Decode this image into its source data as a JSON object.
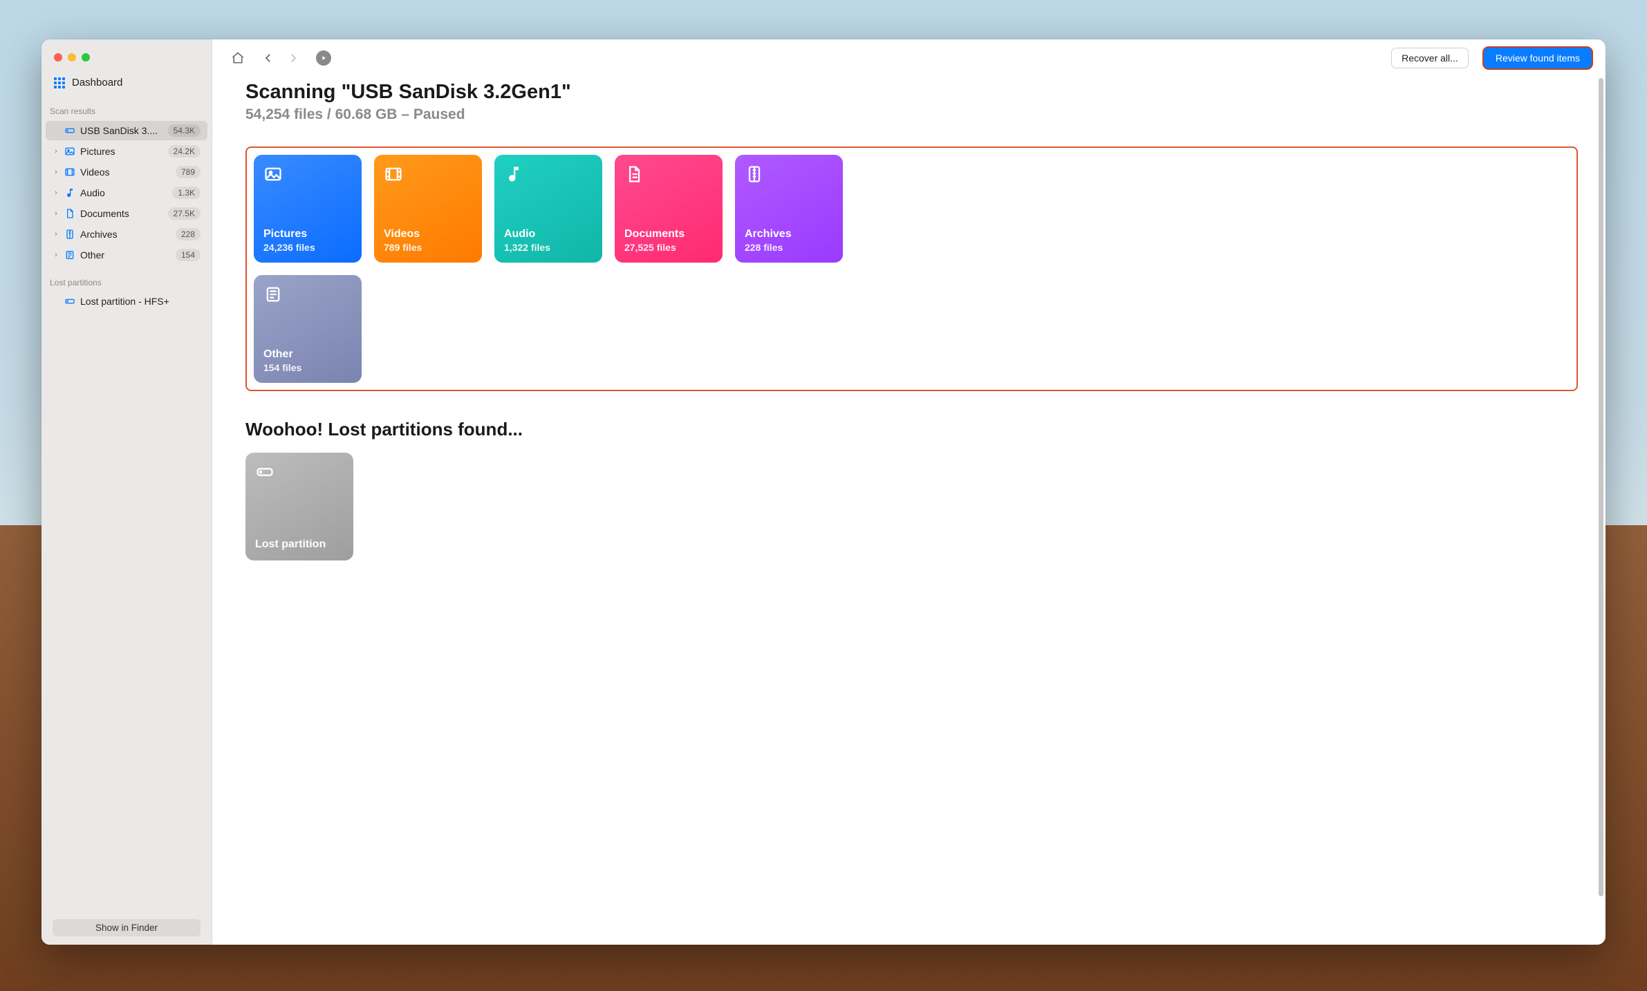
{
  "sidebar": {
    "dashboard_label": "Dashboard",
    "scan_results_label": "Scan results",
    "items": [
      {
        "label": "USB  SanDisk 3....",
        "count": "54.3K",
        "icon": "drive",
        "selected": true
      },
      {
        "label": "Pictures",
        "count": "24.2K",
        "icon": "pictures"
      },
      {
        "label": "Videos",
        "count": "789",
        "icon": "videos"
      },
      {
        "label": "Audio",
        "count": "1.3K",
        "icon": "audio"
      },
      {
        "label": "Documents",
        "count": "27.5K",
        "icon": "documents"
      },
      {
        "label": "Archives",
        "count": "228",
        "icon": "archives"
      },
      {
        "label": "Other",
        "count": "154",
        "icon": "other"
      }
    ],
    "lost_partitions_label": "Lost partitions",
    "lost_partition_item": "Lost partition - HFS+",
    "show_in_finder": "Show in Finder"
  },
  "toolbar": {
    "recover_all": "Recover all...",
    "review_found": "Review found items"
  },
  "scan": {
    "title": "Scanning \"USB  SanDisk 3.2Gen1\"",
    "status": "54,254 files / 60.68 GB – Paused"
  },
  "cards": [
    {
      "kind": "pictures",
      "title": "Pictures",
      "sub": "24,236 files"
    },
    {
      "kind": "videos",
      "title": "Videos",
      "sub": "789 files"
    },
    {
      "kind": "audio",
      "title": "Audio",
      "sub": "1,322 files"
    },
    {
      "kind": "documents",
      "title": "Documents",
      "sub": "27,525 files"
    },
    {
      "kind": "archives",
      "title": "Archives",
      "sub": "228 files"
    },
    {
      "kind": "other",
      "title": "Other",
      "sub": "154 files"
    }
  ],
  "lost": {
    "heading": "Woohoo! Lost partitions found...",
    "card_title": "Lost partition"
  }
}
